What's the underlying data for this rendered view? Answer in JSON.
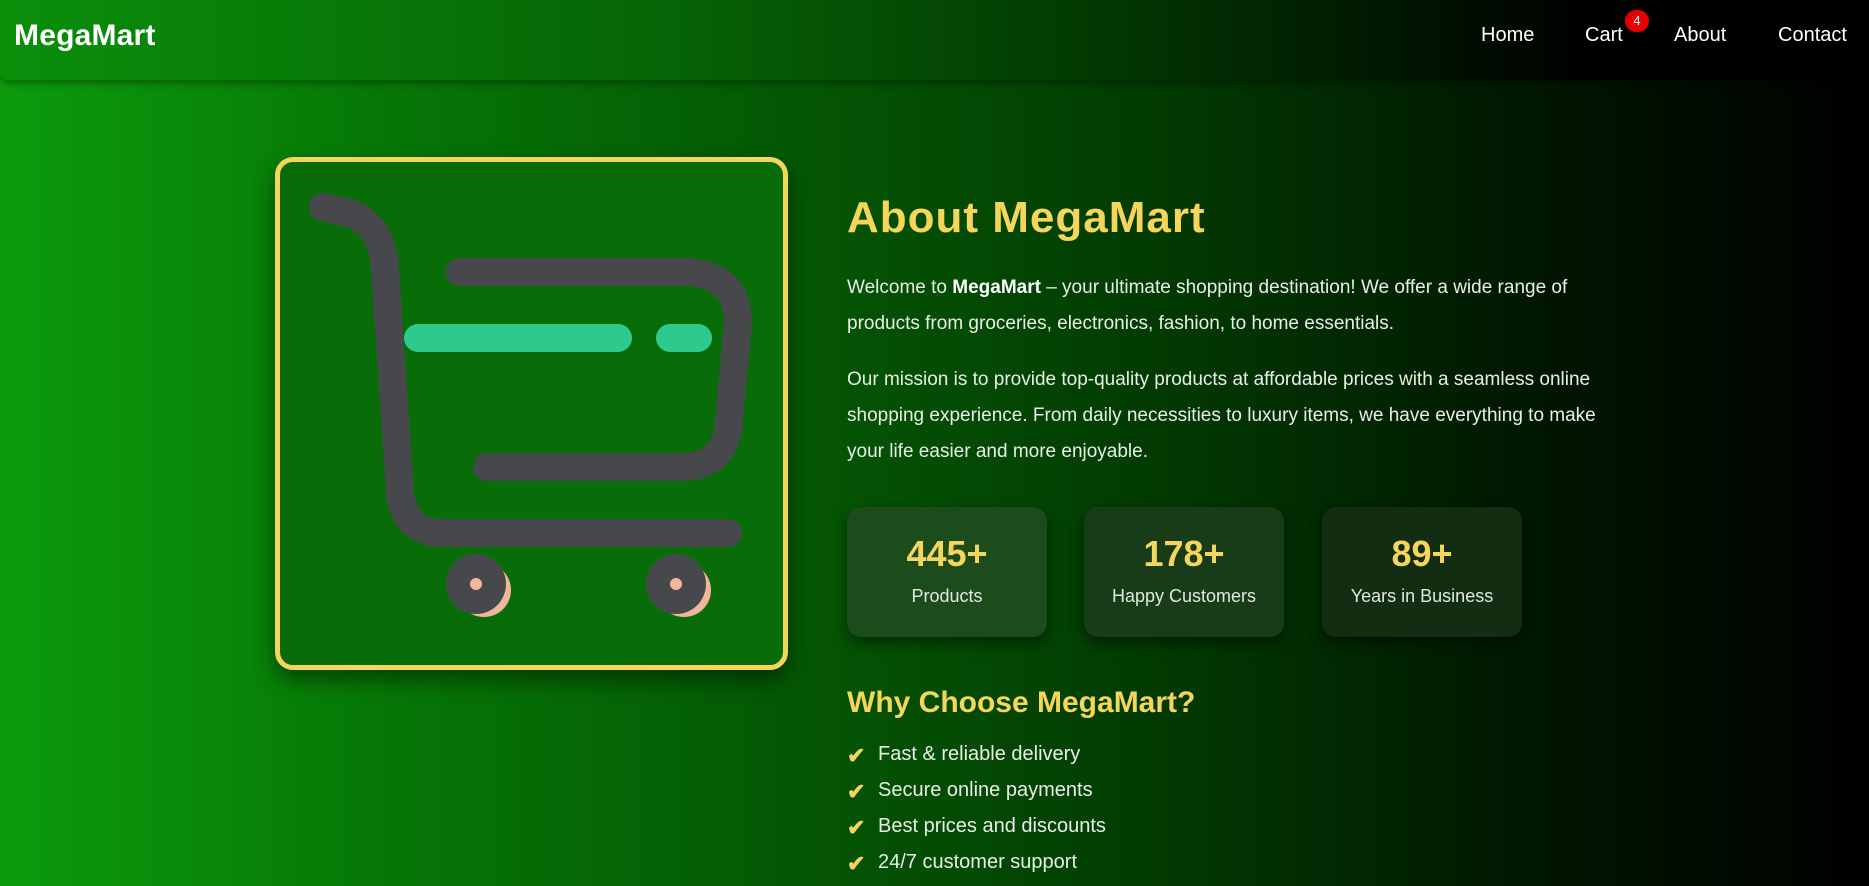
{
  "nav": {
    "brand": "MegaMart",
    "links": [
      "Home",
      "Cart",
      "About",
      "Contact"
    ],
    "cart_count": "4"
  },
  "about": {
    "title": "About MegaMart",
    "intro_prefix": "Welcome to ",
    "intro_brand": "MegaMart",
    "intro_suffix": " – your ultimate shopping destination! We offer a wide range of products from groceries, electronics, fashion, to home essentials.",
    "mission": "Our mission is to provide top-quality products at affordable prices with a seamless online shopping experience. From daily necessities to luxury items, we have everything to make your life easier and more enjoyable."
  },
  "stats": [
    {
      "value": "445+",
      "label": "Products"
    },
    {
      "value": "178+",
      "label": "Happy Customers"
    },
    {
      "value": "89+",
      "label": "Years in Business"
    }
  ],
  "why": {
    "title": "Why Choose MegaMart?",
    "check_icon": "✔",
    "items": [
      "Fast & reliable delivery",
      "Secure online payments",
      "Best prices and discounts",
      "24/7 customer support"
    ]
  },
  "hero_image": {
    "icon": "shopping-cart-icon"
  },
  "colors": {
    "accent": "#f6d55c",
    "cart_body": "#47484c",
    "stripe": "#2ec98c",
    "wheel_accent": "#f2b69c",
    "badge": "#e60000"
  }
}
